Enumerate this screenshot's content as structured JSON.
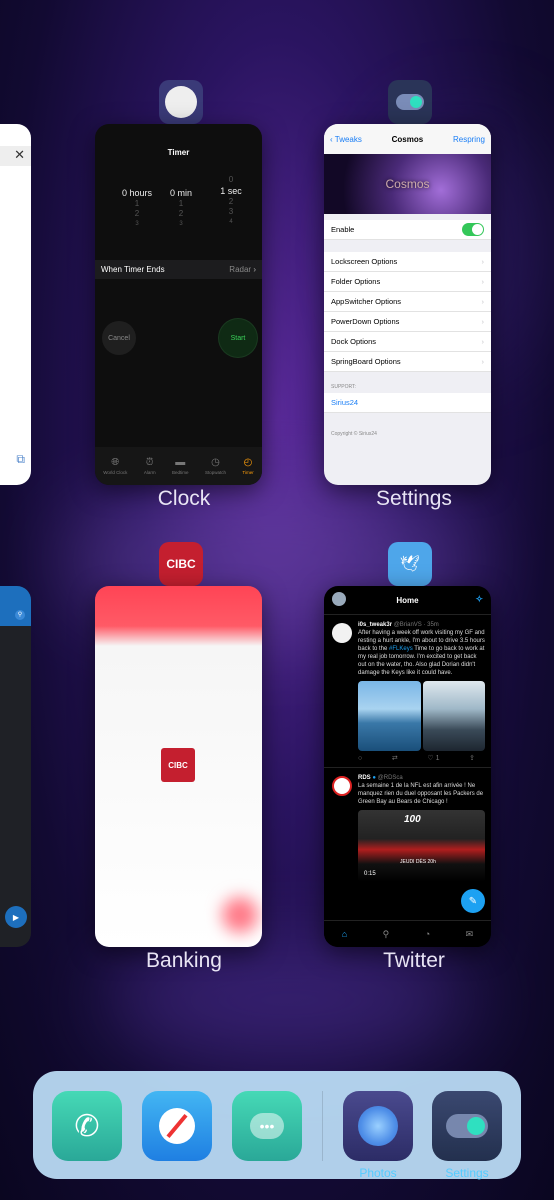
{
  "switcher": {
    "cards": {
      "clock": {
        "label": "Clock",
        "screen": {
          "title": "Timer",
          "picker_hours": {
            "value": "0 hours",
            "above": "",
            "below": [
              "1",
              "2",
              "3"
            ]
          },
          "picker_min": {
            "value": "0 min",
            "above": "",
            "below": [
              "1",
              "2",
              "3"
            ]
          },
          "picker_sec": {
            "value": "1 sec",
            "above": "0",
            "below": [
              "2",
              "3",
              "4"
            ]
          },
          "when_timer_ends_label": "When Timer Ends",
          "when_timer_ends_value": "Radar",
          "cancel_label": "Cancel",
          "start_label": "Start",
          "tabs": [
            "World Clock",
            "Alarm",
            "Bedtime",
            "Stopwatch",
            "Timer"
          ]
        }
      },
      "settings": {
        "label": "Settings",
        "screen": {
          "back_label": "Tweaks",
          "title": "Cosmos",
          "action_label": "Respring",
          "banner_text": "Cosmos",
          "enable_label": "Enable",
          "options": [
            "Lockscreen Options",
            "Folder Options",
            "AppSwitcher Options",
            "PowerDown Options",
            "Dock Options",
            "SpringBoard Options"
          ],
          "support_header": "SUPPORT:",
          "support_link": "Sirius24",
          "copyright": "Copyright © Sirius24"
        }
      },
      "banking": {
        "label": "Banking",
        "screen": {
          "logo_text": "CIBC"
        }
      },
      "twitter": {
        "label": "Twitter",
        "screen": {
          "title": "Home",
          "tweets": [
            {
              "name": "i0s_tweak3r",
              "handle": "@BrianVS · 35m",
              "text_before": "After having a week off work visiting my GF and resting a hurt ankle, I'm about to drive 3.5 hours back to the ",
              "hashtag": "#FLKeys",
              "text_after": " Time to go back to work at my real job tomorrow. I'm excited to get back out on the water, tho. Also glad Dorian didn't damage the Keys like it could have.",
              "likes": "1"
            },
            {
              "name": "RDS",
              "handle": "@RDSca",
              "text": "La semaine 1 de la NFL est afin arrivée ! Ne manquez rien du duel opposant les Packers de Green Bay au Bears de Chicago !",
              "video_time": "0:15",
              "video_badge": "100",
              "video_caption": "JEUDI DÈS 20h"
            }
          ]
        }
      }
    },
    "app_icons": {
      "clock": "clock-icon",
      "settings": "toggle-icon",
      "banking": "CIBC",
      "twitter": "bird-icon"
    }
  },
  "dock": {
    "apps": [
      {
        "name": "phone-icon",
        "label": ""
      },
      {
        "name": "compass-icon",
        "label": ""
      },
      {
        "name": "messages-icon",
        "label": ""
      },
      {
        "name": "photos-icon",
        "label": "Photos"
      },
      {
        "name": "settings-icon",
        "label": "Settings"
      }
    ]
  }
}
